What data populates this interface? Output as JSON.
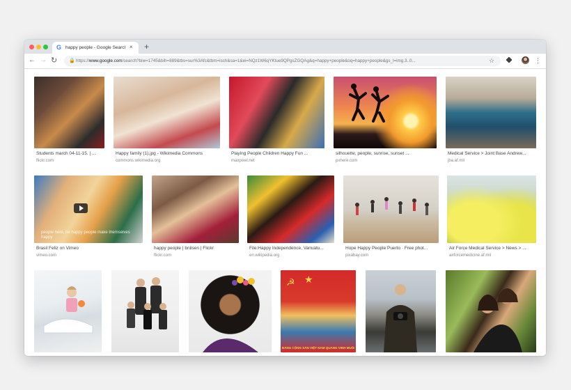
{
  "browser": {
    "tab_title": "happy people - Google Search",
    "tab_favicon": "G",
    "tab_close": "×",
    "new_tab": "+",
    "url_scheme": "https://",
    "url_host": "www.google.com",
    "url_rest": "/search?biw=1745&bih=889&tbs=sur%3Afc&tbm=isch&sa=1&ei=NQz1W6qYKtue9QPgsZGQAg&q=happy+people&oq=happy+people&gs_l=img.3..0...",
    "icons": {
      "back": "←",
      "forward": "→",
      "reload": "↻",
      "lock": "🔒",
      "star": "☆",
      "menu": "⋮"
    }
  },
  "results": [
    {
      "caption": "Students march 04-11-15. | ...",
      "domain": "flickr.com"
    },
    {
      "caption": "Happy family (1).jpg - Wikimedia Commons",
      "domain": "commons.wikimedia.org"
    },
    {
      "caption": "Playing People Children Happy Fun ...",
      "domain": "maxpixel.net"
    },
    {
      "caption": "silhouette, people, sunrise, sunset ...",
      "domain": "pxhere.com"
    },
    {
      "caption": "Medical Service > Joint Base Andrew...",
      "domain": "jba.af.mil"
    },
    {
      "caption": "Brasil Feliz on Vimeo",
      "domain": "vimeo.com",
      "overlay": "people here, be happy people make themselves happy"
    },
    {
      "caption": "happy people | bnilsen | Flickr",
      "domain": "flickr.com"
    },
    {
      "caption": "File:Happy Independence, Vanuatu...",
      "domain": "en.wikipedia.org"
    },
    {
      "caption": "Hope Happy People Puerto · Free phot...",
      "domain": "pixabay.com"
    },
    {
      "caption": "Air Force Medical Service > News > ...",
      "domain": "airforcemedicine.af.mil"
    },
    {
      "caption": "",
      "domain": ""
    },
    {
      "caption": "",
      "domain": ""
    },
    {
      "caption": "",
      "domain": ""
    },
    {
      "caption": "",
      "domain": "",
      "flag_text": "ĐẢNG CỘNG SẢN VIỆT NAM QUANG VINH MUÔN NĂM"
    },
    {
      "caption": "",
      "domain": ""
    },
    {
      "caption": "",
      "domain": ""
    }
  ]
}
